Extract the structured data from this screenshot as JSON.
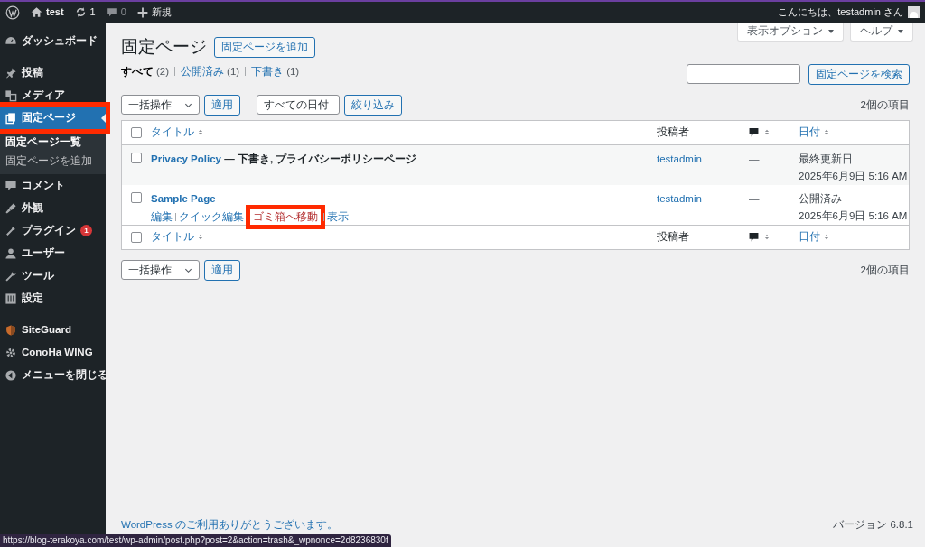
{
  "admin_bar": {
    "site": "test",
    "updates": "1",
    "comments": "0",
    "new": "新規",
    "greeting": "こんにちは、testadmin さん"
  },
  "sidebar": {
    "groups": [
      [
        {
          "label": "ダッシュボード",
          "selected": false,
          "annotated": false
        }
      ],
      [
        {
          "label": "投稿",
          "selected": false,
          "annotated": false
        },
        {
          "label": "メディア",
          "selected": false,
          "annotated": false
        },
        {
          "label": "固定ページ",
          "selected": true,
          "annotated": true,
          "children": [
            {
              "label": "固定ページ一覧",
              "selected": true
            },
            {
              "label": "固定ページを追加",
              "selected": false
            }
          ]
        },
        {
          "label": "コメント",
          "selected": false,
          "annotated": false
        },
        {
          "label": "外観",
          "selected": false,
          "annotated": false
        },
        {
          "label": "プラグイン",
          "selected": false,
          "annotated": false,
          "badge": "1"
        },
        {
          "label": "ユーザー",
          "selected": false,
          "annotated": false
        },
        {
          "label": "ツール",
          "selected": false,
          "annotated": false
        },
        {
          "label": "設定",
          "selected": false,
          "annotated": false
        }
      ],
      [
        {
          "label": "SiteGuard",
          "selected": false,
          "annotated": false
        },
        {
          "label": "ConoHa WING",
          "selected": false,
          "annotated": false
        },
        {
          "label": "メニューを閉じる",
          "selected": false,
          "annotated": false
        }
      ]
    ]
  },
  "screen_meta": [
    "表示オプション",
    "ヘルプ"
  ],
  "page_title": "固定ページ",
  "add_button": "固定ページを追加",
  "views": [
    {
      "label": "すべて",
      "count": "(2)",
      "selected": true
    },
    {
      "label": "公開済み",
      "count": "(1)",
      "selected": false
    },
    {
      "label": "下書き",
      "count": "(1)",
      "selected": false
    }
  ],
  "search_button": "固定ページを検索",
  "top_nav": {
    "bulk": "一括操作",
    "apply": "適用",
    "date_filter": "すべての日付",
    "filter": "絞り込み",
    "count": "2個の項目"
  },
  "table": {
    "header": {
      "checked": false,
      "title": "タイトル",
      "author": "投稿者",
      "date": "日付"
    },
    "rows": [
      {
        "checked": false,
        "title": "Privacy Policy",
        "note": " — 下書き, プライバシーポリシーページ",
        "author": "testadmin",
        "comments": "—",
        "date_status": "最終更新日",
        "date": "2025年6月9日 5:16 AM"
      },
      {
        "checked": false,
        "title": "Sample Page",
        "author": "testadmin",
        "comments": "—",
        "date_status": "公開済み",
        "date": "2025年6月9日 5:16 AM",
        "actions": [
          {
            "label": "編集",
            "kind": "link",
            "annotated": false
          },
          {
            "label": "クイック編集",
            "kind": "link",
            "annotated": false
          },
          {
            "label": "ゴミ箱へ移動",
            "kind": "trash",
            "annotated": true
          },
          {
            "label": "表示",
            "kind": "link",
            "annotated": false
          }
        ]
      }
    ],
    "footer": {
      "checked": false,
      "title": "タイトル",
      "author": "投稿者",
      "date": "日付"
    }
  },
  "bottom_nav": {
    "bulk": "一括操作",
    "apply": "適用",
    "count": "2個の項目"
  },
  "footer": {
    "thanks": "WordPress のご利用ありがとうございます。",
    "version": "バージョン 6.8.1"
  },
  "status_url": "https://blog-terakoya.com/test/wp-admin/post.php?post=2&action=trash&_wpnonce=2d8236830f"
}
